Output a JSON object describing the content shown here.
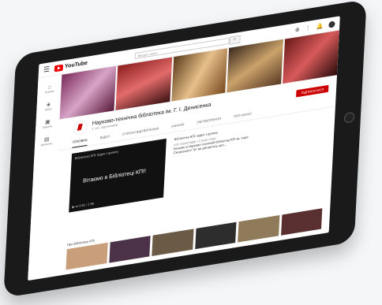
{
  "youtube": {
    "logo_text": "YouTube",
    "search_placeholder": "Введіть запит",
    "sidebar": [
      {
        "label": "Головна",
        "icon": "home-icon"
      },
      {
        "label": "Shorts",
        "icon": "shorts-icon"
      },
      {
        "label": "Підписки",
        "icon": "subscriptions-icon"
      },
      {
        "label": "Бібліотека",
        "icon": "library-icon"
      }
    ],
    "channel": {
      "name": "Науково-технічна бібліотека ім. Г. І. Денисенка",
      "subs": "1 тис. підписників",
      "subscribe_label": "ПІДПИСАТИСЯ"
    },
    "tabs": [
      "ГОЛОВНА",
      "ВІДЕО",
      "СПИСКИ ВІДТВОРЕННЯ",
      "КАНАЛИ",
      "ОБГОВОРЕННЯ",
      "ПРО КАНАЛ"
    ],
    "featured": {
      "video_title_overlay": "Бібліотека КПІ: відео з допису",
      "caption": "Вітаємо в Бібліотеці КПІ!",
      "time": "0:01 / 1:56",
      "title": "Бібліотека КПІ: відео з допису",
      "meta": "441 переглядів • 2 роки тому",
      "desc": "Вітаємо в Науково-технічній бібліотеці КПІ ім. Ігоря Сікорського! Тут ви дізнаєтесь про..."
    },
    "shelf_title": "Про Бібліотеку КПІ"
  }
}
